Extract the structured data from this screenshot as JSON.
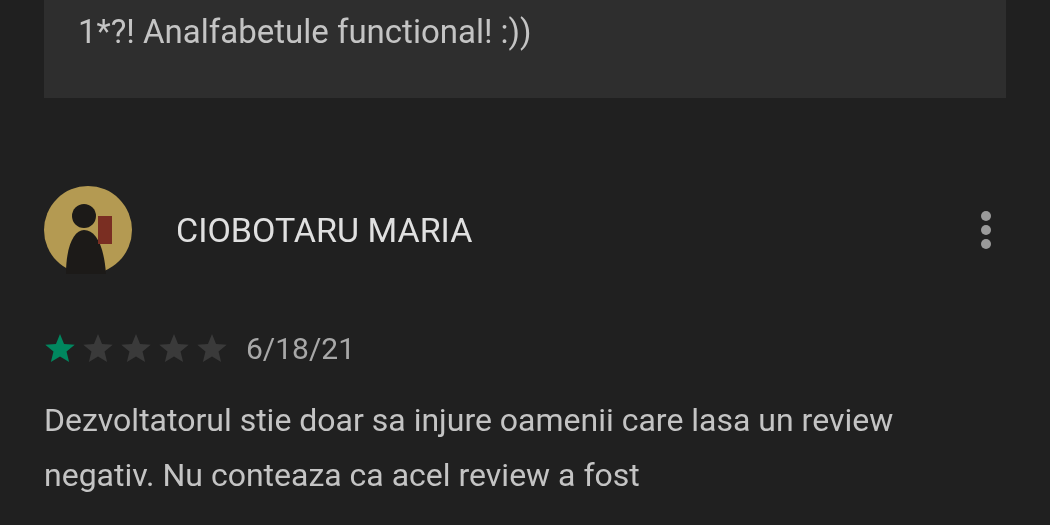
{
  "previous_reply": {
    "text": "1*?! Analfabetule functional! :))"
  },
  "review": {
    "author": "CIOBOTARU MARIA",
    "stars": 1,
    "date": "6/18/21",
    "text": "Dezvoltatorul stie doar sa injure oamenii care lasa un review negativ. Nu conteaza ca acel review a fost"
  }
}
